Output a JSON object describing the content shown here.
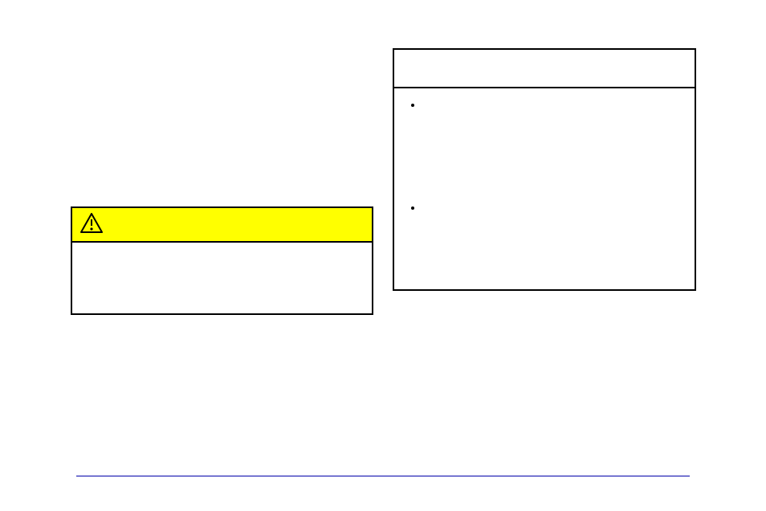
{
  "caution": {
    "header": "",
    "body": "",
    "icon_name": "caution-triangle-icon"
  },
  "info": {
    "header": "",
    "items": [
      {
        "text": ""
      },
      {
        "text": ""
      }
    ]
  }
}
